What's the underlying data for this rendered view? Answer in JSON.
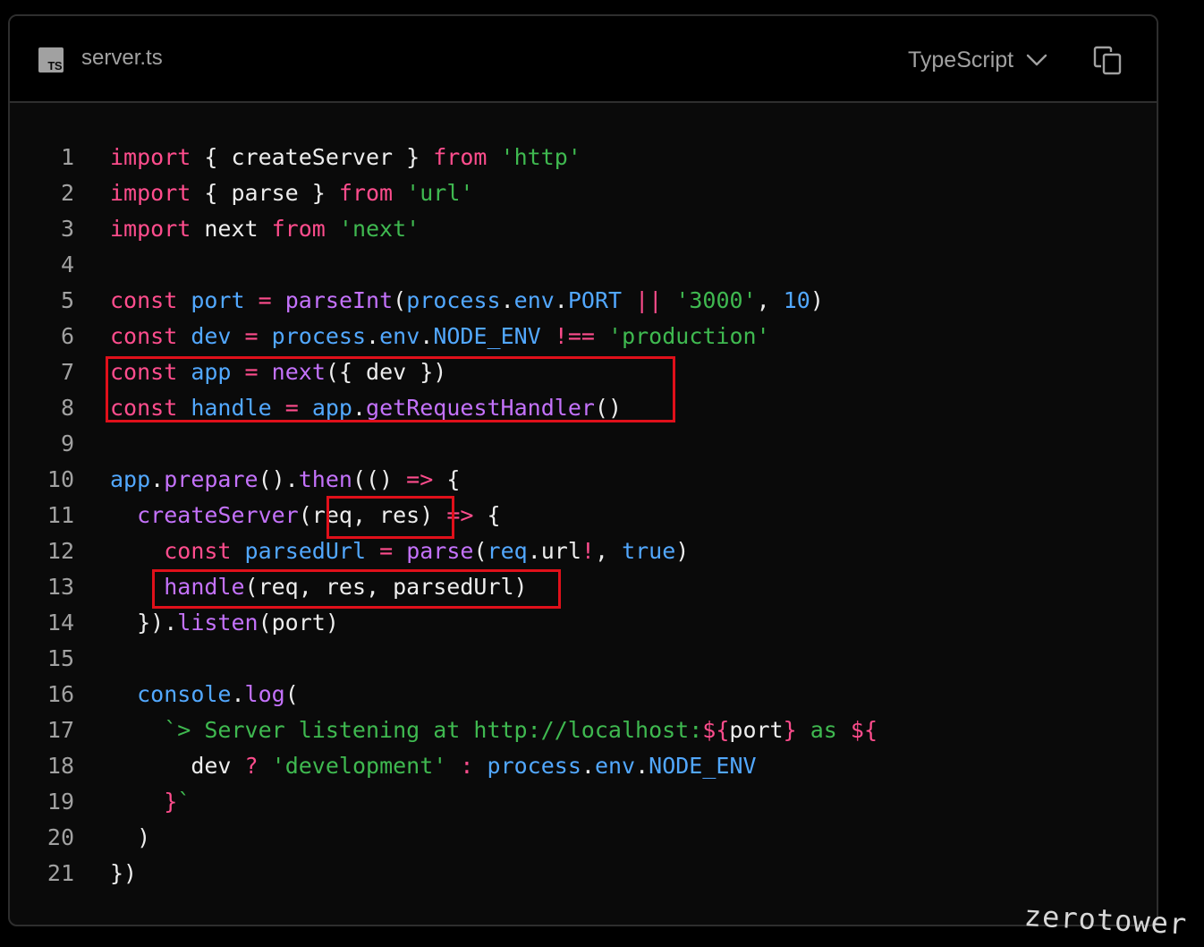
{
  "header": {
    "file_icon_label": "TS",
    "filename": "server.ts",
    "language": "TypeScript",
    "icons": [
      "typescript-file-icon",
      "chevron-down-icon",
      "copy-icon"
    ]
  },
  "code": {
    "lines": [
      {
        "n": "1",
        "tokens": [
          [
            "import",
            "kw"
          ],
          [
            " { createServer } ",
            "pl"
          ],
          [
            "from",
            "kw"
          ],
          [
            " ",
            "pl"
          ],
          [
            "'http'",
            "str"
          ]
        ]
      },
      {
        "n": "2",
        "tokens": [
          [
            "import",
            "kw"
          ],
          [
            " { parse } ",
            "pl"
          ],
          [
            "from",
            "kw"
          ],
          [
            " ",
            "pl"
          ],
          [
            "'url'",
            "str"
          ]
        ]
      },
      {
        "n": "3",
        "tokens": [
          [
            "import",
            "kw"
          ],
          [
            " next ",
            "pl"
          ],
          [
            "from",
            "kw"
          ],
          [
            " ",
            "pl"
          ],
          [
            "'next'",
            "str"
          ]
        ]
      },
      {
        "n": "4",
        "tokens": []
      },
      {
        "n": "5",
        "tokens": [
          [
            "const",
            "kw"
          ],
          [
            " ",
            "pl"
          ],
          [
            "port",
            "id"
          ],
          [
            " ",
            "pl"
          ],
          [
            "=",
            "kw"
          ],
          [
            " ",
            "pl"
          ],
          [
            "parseInt",
            "fn"
          ],
          [
            "(",
            "pl"
          ],
          [
            "process",
            "id"
          ],
          [
            ".",
            "pl"
          ],
          [
            "env",
            "id"
          ],
          [
            ".",
            "pl"
          ],
          [
            "PORT",
            "id"
          ],
          [
            " ",
            "pl"
          ],
          [
            "||",
            "kw"
          ],
          [
            " ",
            "pl"
          ],
          [
            "'3000'",
            "str"
          ],
          [
            ", ",
            "pl"
          ],
          [
            "10",
            "id"
          ],
          [
            ")",
            "pl"
          ]
        ]
      },
      {
        "n": "6",
        "tokens": [
          [
            "const",
            "kw"
          ],
          [
            " ",
            "pl"
          ],
          [
            "dev",
            "id"
          ],
          [
            " ",
            "pl"
          ],
          [
            "=",
            "kw"
          ],
          [
            " ",
            "pl"
          ],
          [
            "process",
            "id"
          ],
          [
            ".",
            "pl"
          ],
          [
            "env",
            "id"
          ],
          [
            ".",
            "pl"
          ],
          [
            "NODE_ENV",
            "id"
          ],
          [
            " ",
            "pl"
          ],
          [
            "!==",
            "kw"
          ],
          [
            " ",
            "pl"
          ],
          [
            "'production'",
            "str"
          ]
        ]
      },
      {
        "n": "7",
        "tokens": [
          [
            "const",
            "kw"
          ],
          [
            " ",
            "pl"
          ],
          [
            "app",
            "id"
          ],
          [
            " ",
            "pl"
          ],
          [
            "=",
            "kw"
          ],
          [
            " ",
            "pl"
          ],
          [
            "next",
            "fn"
          ],
          [
            "({ dev })",
            "pl"
          ]
        ]
      },
      {
        "n": "8",
        "tokens": [
          [
            "const",
            "kw"
          ],
          [
            " ",
            "pl"
          ],
          [
            "handle",
            "id"
          ],
          [
            " ",
            "pl"
          ],
          [
            "=",
            "kw"
          ],
          [
            " ",
            "pl"
          ],
          [
            "app",
            "id"
          ],
          [
            ".",
            "pl"
          ],
          [
            "getRequestHandler",
            "fn"
          ],
          [
            "()",
            "pl"
          ]
        ]
      },
      {
        "n": "9",
        "tokens": []
      },
      {
        "n": "10",
        "tokens": [
          [
            "app",
            "id"
          ],
          [
            ".",
            "pl"
          ],
          [
            "prepare",
            "fn"
          ],
          [
            "().",
            "pl"
          ],
          [
            "then",
            "fn"
          ],
          [
            "(() ",
            "pl"
          ],
          [
            "=>",
            "kw"
          ],
          [
            " {",
            "pl"
          ]
        ]
      },
      {
        "n": "11",
        "tokens": [
          [
            "  ",
            "pl"
          ],
          [
            "createServer",
            "fn"
          ],
          [
            "(",
            "pl"
          ],
          [
            "req, res",
            "pl"
          ],
          [
            ")",
            "pl"
          ],
          [
            " ",
            "pl"
          ],
          [
            "=>",
            "kw"
          ],
          [
            " {",
            "pl"
          ]
        ]
      },
      {
        "n": "12",
        "tokens": [
          [
            "    ",
            "pl"
          ],
          [
            "const",
            "kw"
          ],
          [
            " ",
            "pl"
          ],
          [
            "parsedUrl",
            "id"
          ],
          [
            " ",
            "pl"
          ],
          [
            "=",
            "kw"
          ],
          [
            " ",
            "pl"
          ],
          [
            "parse",
            "fn"
          ],
          [
            "(",
            "pl"
          ],
          [
            "req",
            "id"
          ],
          [
            ".url",
            "pl"
          ],
          [
            "!",
            "kw"
          ],
          [
            ", ",
            "pl"
          ],
          [
            "true",
            "id"
          ],
          [
            ")",
            "pl"
          ]
        ]
      },
      {
        "n": "13",
        "tokens": [
          [
            "    ",
            "pl"
          ],
          [
            "handle",
            "fn"
          ],
          [
            "(req, res, parsedUrl)",
            "pl"
          ]
        ]
      },
      {
        "n": "14",
        "tokens": [
          [
            "  }).",
            "pl"
          ],
          [
            "listen",
            "fn"
          ],
          [
            "(port)",
            "pl"
          ]
        ]
      },
      {
        "n": "15",
        "tokens": []
      },
      {
        "n": "16",
        "tokens": [
          [
            "  ",
            "pl"
          ],
          [
            "console",
            "id"
          ],
          [
            ".",
            "pl"
          ],
          [
            "log",
            "fn"
          ],
          [
            "(",
            "pl"
          ]
        ]
      },
      {
        "n": "17",
        "tokens": [
          [
            "    ",
            "pl"
          ],
          [
            "`> Server listening at http://localhost:",
            "str"
          ],
          [
            "${",
            "kw"
          ],
          [
            "port",
            "pl"
          ],
          [
            "}",
            "kw"
          ],
          [
            " as ",
            "str"
          ],
          [
            "${",
            "kw"
          ]
        ]
      },
      {
        "n": "18",
        "tokens": [
          [
            "      ",
            "pl"
          ],
          [
            "dev ",
            "pl"
          ],
          [
            "?",
            "kw"
          ],
          [
            " ",
            "pl"
          ],
          [
            "'development'",
            "str"
          ],
          [
            " ",
            "pl"
          ],
          [
            ":",
            "kw"
          ],
          [
            " ",
            "pl"
          ],
          [
            "process",
            "id"
          ],
          [
            ".",
            "pl"
          ],
          [
            "env",
            "id"
          ],
          [
            ".",
            "pl"
          ],
          [
            "NODE_ENV",
            "id"
          ]
        ]
      },
      {
        "n": "19",
        "tokens": [
          [
            "    ",
            "pl"
          ],
          [
            "}",
            "kw"
          ],
          [
            "`",
            "str"
          ]
        ]
      },
      {
        "n": "20",
        "tokens": [
          [
            "  )",
            "pl"
          ]
        ]
      },
      {
        "n": "21",
        "tokens": [
          [
            "})",
            "pl"
          ]
        ]
      }
    ]
  },
  "highlight_color": "#e0101a",
  "watermark": "zerotower"
}
